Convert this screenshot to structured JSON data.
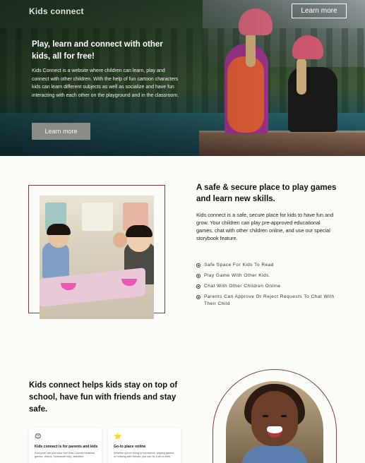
{
  "header": {
    "logo": "Kids connect",
    "cta_label": "Learn more"
  },
  "hero": {
    "title": "Play, learn and connect with other kids, all for free!",
    "description": "Kids Connect is a website where children can learn, play and connect with other children. With the help of fun cartoon characters kids can learn different subjects as well as socialize and have fun interacting with each other on the playground and in the classroom.",
    "button_label": "Learn more"
  },
  "safe_section": {
    "title": "A safe & secure place to play games and learn new skills.",
    "description": "Kids connect is a safe, secure place for kids to have fun and grow. Your children can play pre-approved educational games, chat with other children online, and use our special storybook feature.",
    "features": [
      "Safe Space For Kids To Read",
      "Play Game With Other Kids.",
      "Chat With Other Children Online",
      "Parents Can Approve Or Reject Requests To Chat With Their Child"
    ]
  },
  "stay_section": {
    "title": "Kids connect helps kids stay on top of school, have fun with friends and stay safe.",
    "cards": [
      {
        "icon": "😊",
        "icon_name": "smiley-icon",
        "title": "Kids connect is for parents and kids",
        "text": "Everyone can just have fun! Kids Connect features games, videos, homework help, activities."
      },
      {
        "icon": "⭐",
        "icon_name": "star-icon",
        "title": "Go-to place online",
        "text": "Whether you're doing to homework, playing games or relaxing with friends, you can do it all on Kids"
      }
    ]
  },
  "colors": {
    "accent_border": "#7d3a44",
    "hero_button_bg": "#8a8d86",
    "page_bg": "#fcfcf8"
  }
}
